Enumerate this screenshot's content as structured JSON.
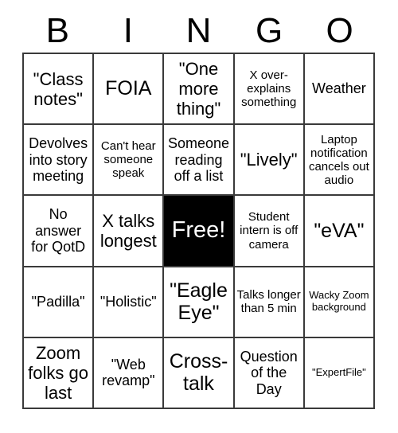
{
  "card": {
    "title_letters": [
      "B",
      "I",
      "N",
      "G",
      "O"
    ],
    "free_space_label": "Free!",
    "rows": [
      [
        {
          "text": "\"Class notes\"",
          "size": "lg"
        },
        {
          "text": "FOIA",
          "size": "xl"
        },
        {
          "text": "\"One more thing\"",
          "size": "lg"
        },
        {
          "text": "X over-explains something",
          "size": "sm"
        },
        {
          "text": "Weather",
          "size": "md"
        }
      ],
      [
        {
          "text": "Devolves into story meeting",
          "size": "md"
        },
        {
          "text": "Can't hear someone speak",
          "size": "sm"
        },
        {
          "text": "Someone reading off a list",
          "size": "md"
        },
        {
          "text": "\"Lively\"",
          "size": "lg"
        },
        {
          "text": "Laptop notification cancels out audio",
          "size": "sm"
        }
      ],
      [
        {
          "text": "No answer for QotD",
          "size": "md"
        },
        {
          "text": "X talks longest",
          "size": "lg"
        },
        {
          "text": "Free!",
          "size": "free",
          "free": true
        },
        {
          "text": "Student intern is off camera",
          "size": "sm"
        },
        {
          "text": "\"eVA\"",
          "size": "xl"
        }
      ],
      [
        {
          "text": "\"Padilla\"",
          "size": "md"
        },
        {
          "text": "\"Holistic\"",
          "size": "md"
        },
        {
          "text": "\"Eagle Eye\"",
          "size": "xl"
        },
        {
          "text": "Talks longer than 5 min",
          "size": "sm"
        },
        {
          "text": "Wacky Zoom background",
          "size": "xs"
        }
      ],
      [
        {
          "text": "Zoom folks go last",
          "size": "lg"
        },
        {
          "text": "\"Web revamp\"",
          "size": "md"
        },
        {
          "text": "Cross-talk",
          "size": "xl"
        },
        {
          "text": "Question of the Day",
          "size": "md"
        },
        {
          "text": "\"ExpertFile\"",
          "size": "xs"
        }
      ]
    ]
  },
  "colors": {
    "grid_line": "#3a3a3a",
    "text": "#000000",
    "free_background": "#000000",
    "free_text": "#ffffff",
    "page_background": "#ffffff"
  }
}
